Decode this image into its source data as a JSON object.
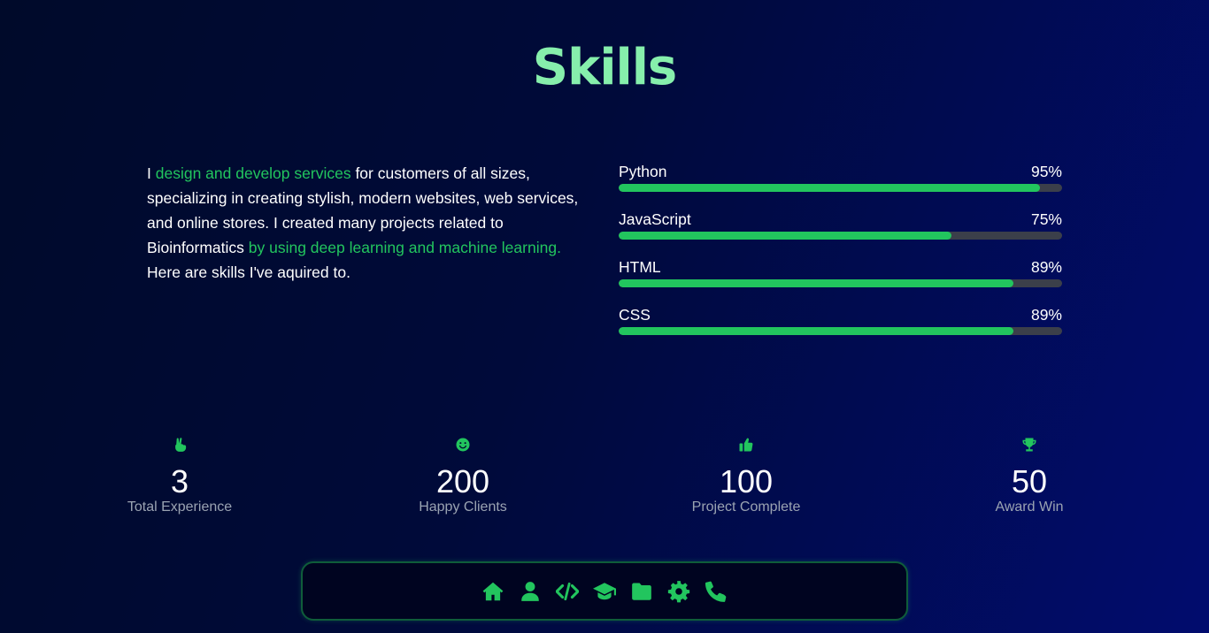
{
  "page": {
    "title": "Skills"
  },
  "about": {
    "p1": "I ",
    "hl1": "design and develop services",
    "p2": " for customers of all sizes, specializing in creating stylish, modern websites, web services, and online stores. I created many projects related to Bioinformatics ",
    "hl2": "by using deep learning and machine learning.",
    "p3": " Here are skills I've aquired to."
  },
  "skills": [
    {
      "name": "Python",
      "percent_label": "95%",
      "level": 0.95
    },
    {
      "name": "JavaScript",
      "percent_label": "75%",
      "level": 0.75
    },
    {
      "name": "HTML",
      "percent_label": "89%",
      "level": 0.89
    },
    {
      "name": "CSS",
      "percent_label": "89%",
      "level": 0.89
    }
  ],
  "stats": [
    {
      "icon": "hand-peace-icon",
      "value": "3",
      "label": "Total Experience"
    },
    {
      "icon": "smile-icon",
      "value": "200",
      "label": "Happy Clients"
    },
    {
      "icon": "thumbs-up-icon",
      "value": "100",
      "label": "Project Complete"
    },
    {
      "icon": "trophy-icon",
      "value": "50",
      "label": "Award Win"
    }
  ],
  "nav": [
    {
      "icon": "home-icon"
    },
    {
      "icon": "user-icon"
    },
    {
      "icon": "code-icon"
    },
    {
      "icon": "graduation-cap-icon"
    },
    {
      "icon": "folder-icon"
    },
    {
      "icon": "gear-icon"
    },
    {
      "icon": "phone-icon"
    }
  ],
  "colors": {
    "accent": "#22c55e",
    "title": "#86efac",
    "track": "#3b3f4a"
  }
}
